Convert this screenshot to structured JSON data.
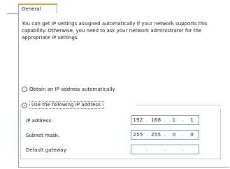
{
  "tab": {
    "label": "General"
  },
  "intro_text": "You can get IP settings assigned automatically if your network supports this capability. Otherwise, you need to ask your network administrator for the appropriate IP settings.",
  "options": {
    "auto": {
      "label": "Obtain an IP address automatically",
      "selected": false
    },
    "manual": {
      "label": "Use the following IP address:",
      "selected": true
    }
  },
  "fields": {
    "ip_address": {
      "label": "IP address:",
      "octets": [
        "192",
        "168",
        "1",
        "1"
      ]
    },
    "subnet_mask": {
      "label": "Subnet mask:",
      "octets": [
        "255",
        "255",
        "0",
        "0"
      ]
    },
    "default_gateway": {
      "label": "Default gateway:",
      "octets": [
        "",
        "",
        "",
        ""
      ]
    }
  }
}
